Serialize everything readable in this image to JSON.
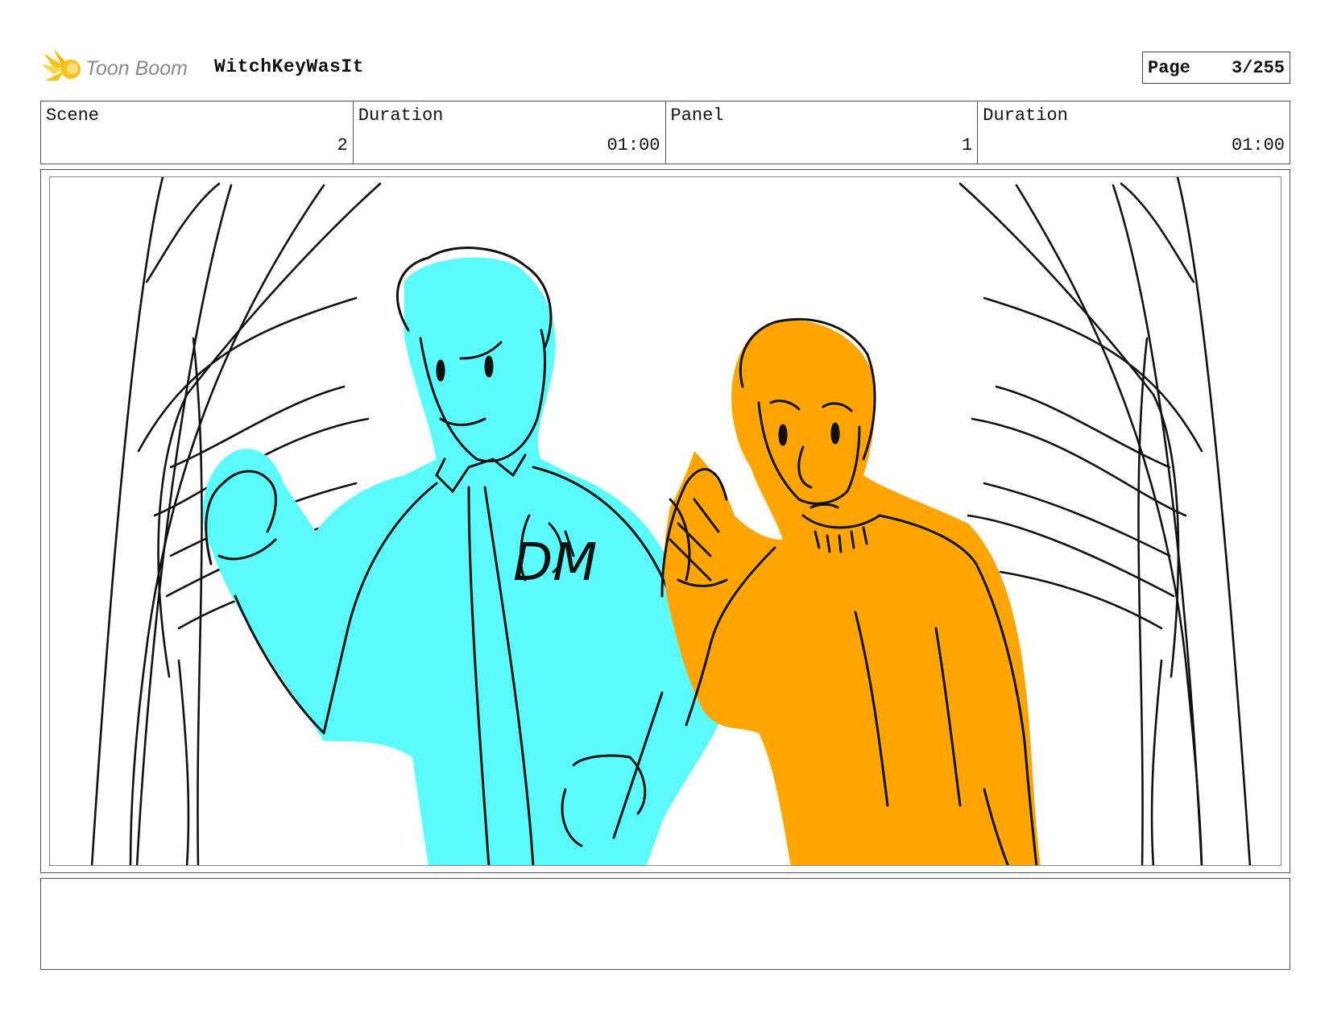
{
  "header": {
    "brand": "Toon Boom",
    "project_title": "WitchKeyWasIt",
    "page_label": "Page",
    "page_value": "3/255"
  },
  "info": {
    "scene_label": "Scene",
    "scene_value": "2",
    "scene_duration_label": "Duration",
    "scene_duration_value": "01:00",
    "panel_label": "Panel",
    "panel_value": "1",
    "panel_duration_label": "Duration",
    "panel_duration_value": "01:00"
  },
  "panel": {
    "drawing": "storyboard-sketch",
    "left_figure_color": "#5bfafb",
    "right_figure_color": "#ffa500",
    "jacket_initials": "DM"
  },
  "notes": {
    "text": ""
  },
  "colors": {
    "logo_yellow": "#f7c21a",
    "logo_gray": "#8a8a8a"
  }
}
